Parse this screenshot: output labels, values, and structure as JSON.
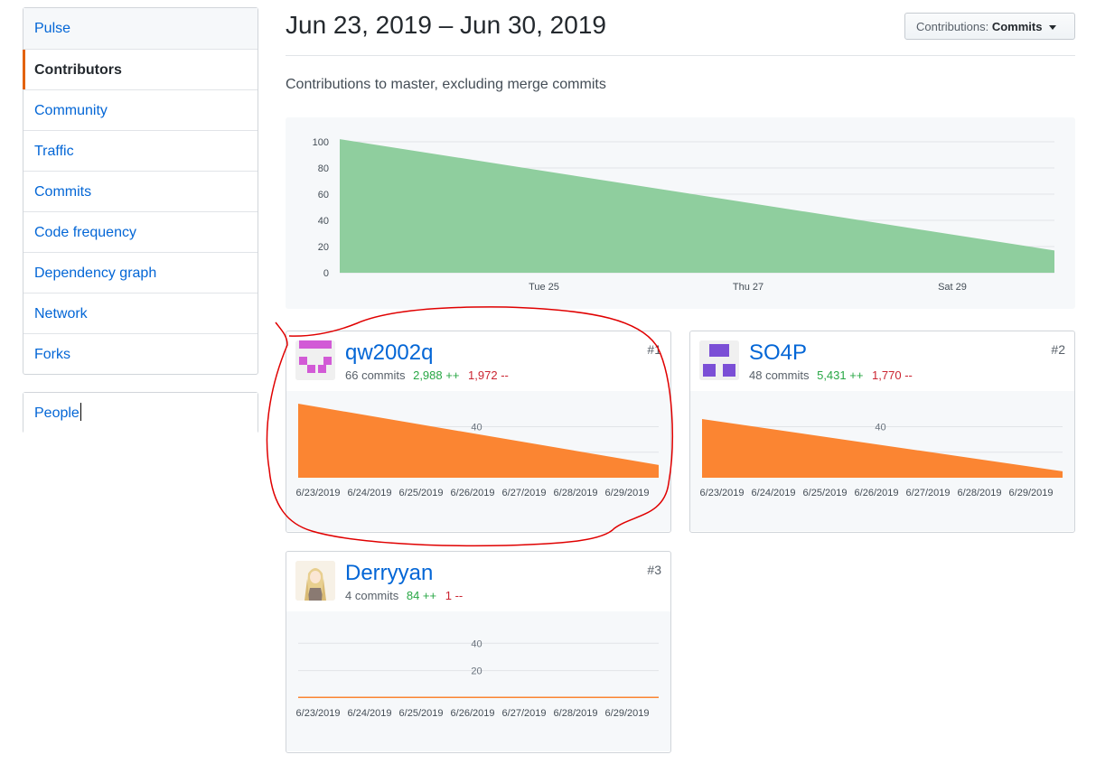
{
  "sidebar": {
    "items": [
      {
        "label": "Pulse"
      },
      {
        "label": "Contributors"
      },
      {
        "label": "Community"
      },
      {
        "label": "Traffic"
      },
      {
        "label": "Commits"
      },
      {
        "label": "Code frequency"
      },
      {
        "label": "Dependency graph"
      },
      {
        "label": "Network"
      },
      {
        "label": "Forks"
      }
    ],
    "secondary": {
      "label": "People"
    }
  },
  "header": {
    "date_range": "Jun 23, 2019 – Jun 30, 2019",
    "select_prefix": "Contributions:",
    "select_value": "Commits",
    "subtitle": "Contributions to master, excluding merge commits"
  },
  "colors": {
    "accent": "#e36209",
    "main_area": "#8fce9e",
    "contributor_area": "#fb8532",
    "link": "#0366d6",
    "additions": "#28a745",
    "deletions": "#cb2431",
    "annotation": "#e00000"
  },
  "chart_data": [
    {
      "type": "area",
      "title": "",
      "x_tick_labels": [
        "Tue 25",
        "Thu 27",
        "Sat 29"
      ],
      "y_tick_labels": [
        "0",
        "20",
        "40",
        "60",
        "80",
        "100"
      ],
      "ylim": [
        0,
        100
      ],
      "x": [
        "2019-06-23",
        "2019-06-30"
      ],
      "series": [
        {
          "values": [
            102,
            17
          ]
        }
      ],
      "grid": true
    },
    {
      "type": "area",
      "contributor": "qw2002q",
      "x_tick_labels": [
        "6/23/2019",
        "6/24/2019",
        "6/25/2019",
        "6/26/2019",
        "6/27/2019",
        "6/28/2019",
        "6/29/2019"
      ],
      "y_tick_labels": [
        "40"
      ],
      "ylim": [
        0,
        58
      ],
      "x": [
        "2019-06-23",
        "2019-06-30"
      ],
      "series": [
        {
          "values": [
            58,
            10
          ]
        }
      ],
      "grid": true
    },
    {
      "type": "area",
      "contributor": "SO4P",
      "x_tick_labels": [
        "6/23/2019",
        "6/24/2019",
        "6/25/2019",
        "6/26/2019",
        "6/27/2019",
        "6/28/2019",
        "6/29/2019"
      ],
      "y_tick_labels": [
        "40"
      ],
      "ylim": [
        0,
        58
      ],
      "x": [
        "2019-06-23",
        "2019-06-30"
      ],
      "series": [
        {
          "values": [
            46,
            5
          ]
        }
      ],
      "grid": true
    },
    {
      "type": "area",
      "contributor": "Derryyan",
      "x_tick_labels": [
        "6/23/2019",
        "6/24/2019",
        "6/25/2019",
        "6/26/2019",
        "6/27/2019",
        "6/28/2019",
        "6/29/2019"
      ],
      "y_tick_labels": [
        "20",
        "40"
      ],
      "ylim": [
        0,
        58
      ],
      "x": [
        "2019-06-23",
        "2019-06-30"
      ],
      "series": [
        {
          "values": [
            1,
            1
          ]
        }
      ],
      "grid": true
    }
  ],
  "contributors": [
    {
      "login": "qw2002q",
      "commits": "66 commits",
      "additions": "2,988 ++",
      "deletions": "1,972 --",
      "rank": "#1",
      "avatar": "identicon-pink-icon"
    },
    {
      "login": "SO4P",
      "commits": "48 commits",
      "additions": "5,431 ++",
      "deletions": "1,770 --",
      "rank": "#2",
      "avatar": "identicon-purple-icon"
    },
    {
      "login": "Derryyan",
      "commits": "4 commits",
      "additions": "84 ++",
      "deletions": "1 --",
      "rank": "#3",
      "avatar": "anime-avatar-icon"
    }
  ]
}
